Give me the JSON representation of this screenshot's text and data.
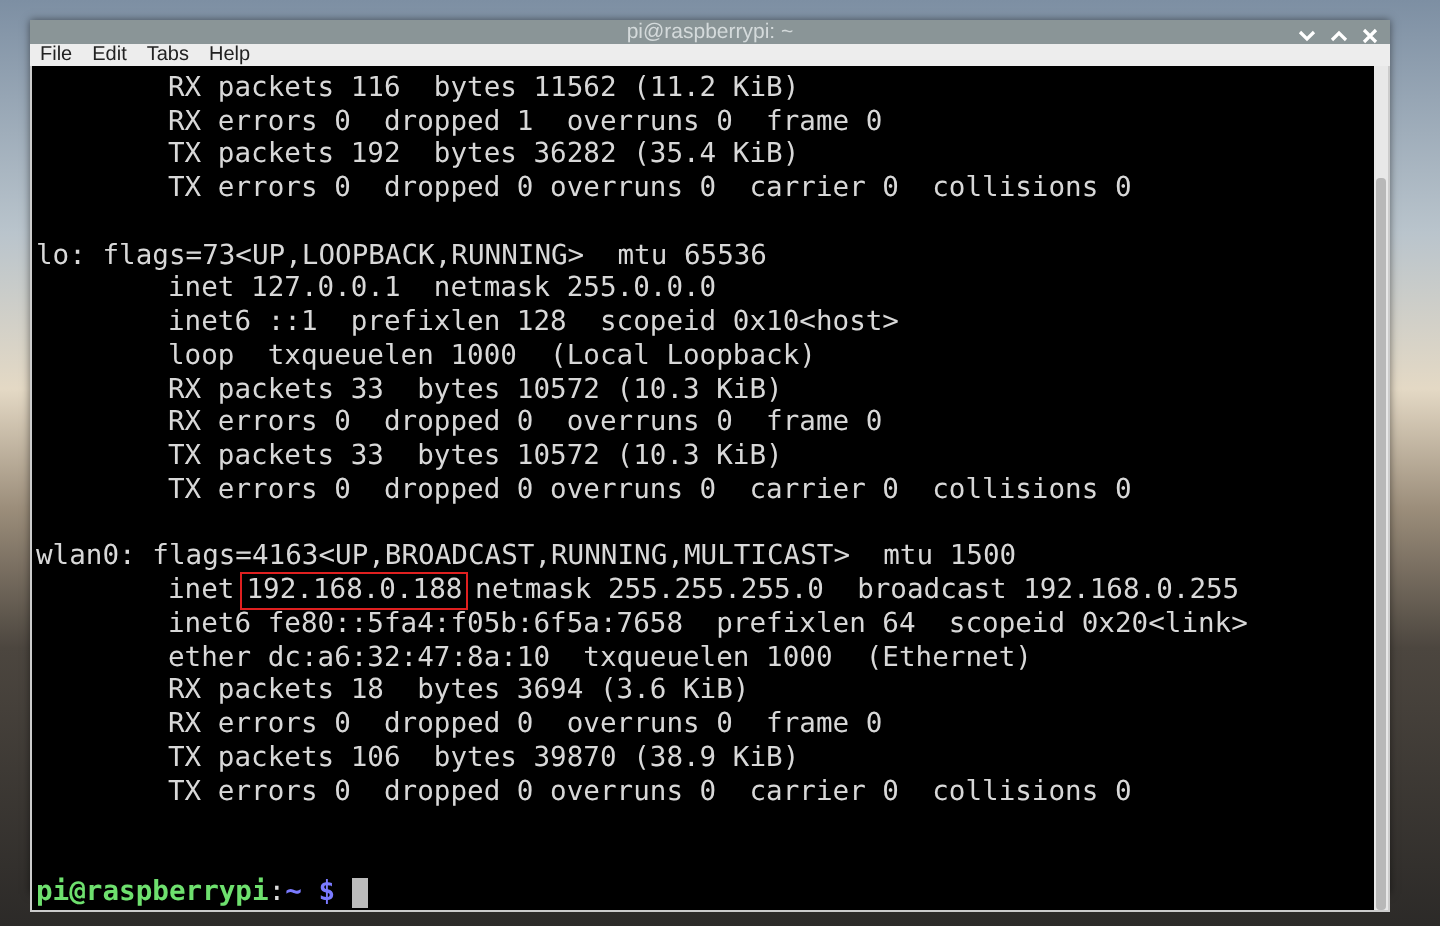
{
  "window": {
    "title": "pi@raspberrypi: ~"
  },
  "menu": [
    "File",
    "Edit",
    "Tabs",
    "Help"
  ],
  "terminal": {
    "lines": [
      {
        "kind": "plain",
        "indented": true,
        "text": "RX packets 116  bytes 11562 (11.2 KiB)"
      },
      {
        "kind": "plain",
        "indented": true,
        "text": "RX errors 0  dropped 1  overruns 0  frame 0"
      },
      {
        "kind": "plain",
        "indented": true,
        "text": "TX packets 192  bytes 36282 (35.4 KiB)"
      },
      {
        "kind": "plain",
        "indented": true,
        "text": "TX errors 0  dropped 0 overruns 0  carrier 0  collisions 0"
      },
      {
        "kind": "blank"
      },
      {
        "kind": "plain",
        "indented": false,
        "text": "lo: flags=73<UP,LOOPBACK,RUNNING>  mtu 65536"
      },
      {
        "kind": "plain",
        "indented": true,
        "text": "inet 127.0.0.1  netmask 255.0.0.0"
      },
      {
        "kind": "plain",
        "indented": true,
        "text": "inet6 ::1  prefixlen 128  scopeid 0x10<host>"
      },
      {
        "kind": "plain",
        "indented": true,
        "text": "loop  txqueuelen 1000  (Local Loopback)"
      },
      {
        "kind": "plain",
        "indented": true,
        "text": "RX packets 33  bytes 10572 (10.3 KiB)"
      },
      {
        "kind": "plain",
        "indented": true,
        "text": "RX errors 0  dropped 0  overruns 0  frame 0"
      },
      {
        "kind": "plain",
        "indented": true,
        "text": "TX packets 33  bytes 10572 (10.3 KiB)"
      },
      {
        "kind": "plain",
        "indented": true,
        "text": "TX errors 0  dropped 0 overruns 0  carrier 0  collisions 0"
      },
      {
        "kind": "blank"
      },
      {
        "kind": "plain",
        "indented": false,
        "text": "wlan0: flags=4163<UP,BROADCAST,RUNNING,MULTICAST>  mtu 1500"
      },
      {
        "kind": "parts",
        "indented": true,
        "parts": [
          {
            "text": "inet",
            "boxed": false
          },
          {
            "text": "192.168.0.188",
            "boxed": true
          },
          {
            "text": "netmask 255.255.255.0  broadcast 192.168.0.255",
            "boxed": false
          }
        ]
      },
      {
        "kind": "plain",
        "indented": true,
        "text": "inet6 fe80::5fa4:f05b:6f5a:7658  prefixlen 64  scopeid 0x20<link>"
      },
      {
        "kind": "plain",
        "indented": true,
        "text": "ether dc:a6:32:47:8a:10  txqueuelen 1000  (Ethernet)"
      },
      {
        "kind": "plain",
        "indented": true,
        "text": "RX packets 18  bytes 3694 (3.6 KiB)"
      },
      {
        "kind": "plain",
        "indented": true,
        "text": "RX errors 0  dropped 0  overruns 0  frame 0"
      },
      {
        "kind": "plain",
        "indented": true,
        "text": "TX packets 106  bytes 39870 (38.9 KiB)"
      },
      {
        "kind": "plain",
        "indented": true,
        "text": "TX errors 0  dropped 0 overruns 0  carrier 0  collisions 0"
      },
      {
        "kind": "blank"
      }
    ],
    "prompt": {
      "user": "pi@raspberrypi",
      "separator": ":",
      "path": "~",
      "symbol": "$"
    }
  }
}
